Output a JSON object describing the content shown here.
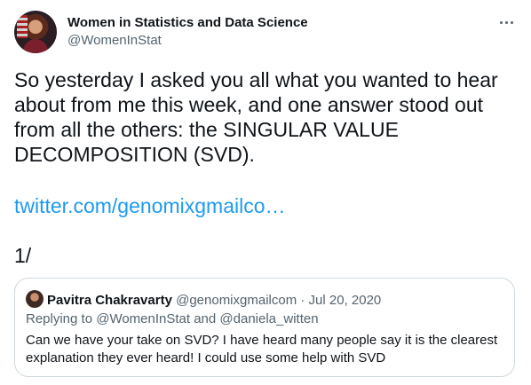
{
  "author": {
    "display_name": "Women in Statistics and Data Science",
    "handle": "@WomenInStat"
  },
  "tweet": {
    "text": "So yesterday I asked you all what you wanted to hear about from me this week, and one answer stood out from all the others: the SINGULAR VALUE DECOMPOSITION (SVD).",
    "link": "twitter.com/genomixgmailco…",
    "thread_marker": "1/"
  },
  "quoted_tweet": {
    "display_name": "Pavitra Chakravarty",
    "handle": "@genomixgmailcom",
    "separator": " · ",
    "date": "Jul 20, 2020",
    "replying_prefix": "Replying to ",
    "replying_to_1": "@WomenInStat",
    "replying_and": " and ",
    "replying_to_2": "@daniela_witten",
    "text": "Can we have your take on SVD? I have heard many people say it is the clearest explanation they ever heard! I could use some help with SVD"
  },
  "icons": {
    "more": "more-horizontal-icon"
  },
  "colors": {
    "link": "#1d9bf0",
    "secondary_text": "#536471",
    "border": "#cfd9de"
  }
}
